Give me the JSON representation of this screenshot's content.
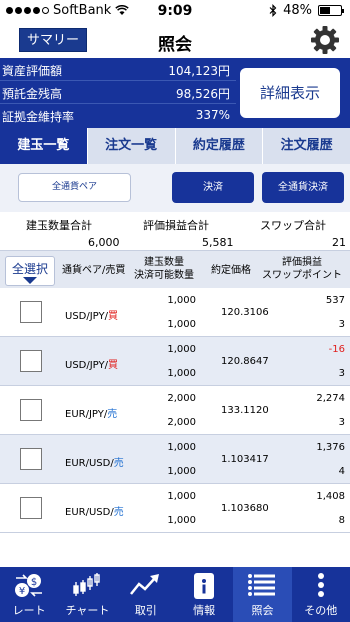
{
  "status": {
    "carrier": "SoftBank",
    "time": "9:09",
    "battery": "48%",
    "battery_level": 0.48
  },
  "nav": {
    "summary_label": "サマリー",
    "title": "照会"
  },
  "account": {
    "rows": [
      {
        "label": "資産評価額",
        "value": "104,123円"
      },
      {
        "label": "預託金残高",
        "value": "98,526円"
      },
      {
        "label": "証拠金維持率",
        "value": "337%"
      }
    ],
    "detail_label": "詳細表示"
  },
  "tabs": [
    {
      "label": "建玉一覧",
      "active": true
    },
    {
      "label": "注文一覧",
      "active": false
    },
    {
      "label": "約定履歴",
      "active": false
    },
    {
      "label": "注文履歴",
      "active": false
    }
  ],
  "actions": {
    "all_pairs": "全通貨ペア",
    "settle": "決済",
    "settle_all": "全通貨決済"
  },
  "totals": {
    "qty_label": "建玉数量合計",
    "qty_value": "6,000",
    "pl_label": "評価損益合計",
    "pl_value": "5,581",
    "swap_label": "スワップ合計",
    "swap_value": "21"
  },
  "table": {
    "select_all": "全選択",
    "headers": {
      "pair": "通貨ペア/売買",
      "qty1": "建玉数量",
      "qty2": "決済可能数量",
      "price": "約定価格",
      "pl1": "評価損益",
      "pl2": "スワップポイント"
    },
    "rows": [
      {
        "pair": "USD/JPY/",
        "side": "買",
        "side_type": "buy",
        "qty": "1,000",
        "settleable": "1,000",
        "price": "120.3106",
        "pl": "537",
        "pl_negative": false,
        "swap": "3"
      },
      {
        "pair": "USD/JPY/",
        "side": "買",
        "side_type": "buy",
        "qty": "1,000",
        "settleable": "1,000",
        "price": "120.8647",
        "pl": "-16",
        "pl_negative": true,
        "swap": "3"
      },
      {
        "pair": "EUR/JPY/",
        "side": "売",
        "side_type": "sell",
        "qty": "2,000",
        "settleable": "2,000",
        "price": "133.1120",
        "pl": "2,274",
        "pl_negative": false,
        "swap": "3"
      },
      {
        "pair": "EUR/USD/",
        "side": "売",
        "side_type": "sell",
        "qty": "1,000",
        "settleable": "1,000",
        "price": "1.103417",
        "pl": "1,376",
        "pl_negative": false,
        "swap": "4"
      },
      {
        "pair": "EUR/USD/",
        "side": "売",
        "side_type": "sell",
        "qty": "1,000",
        "settleable": "1,000",
        "price": "1.103680",
        "pl": "1,408",
        "pl_negative": false,
        "swap": "8"
      }
    ]
  },
  "footer": [
    {
      "label": "レート",
      "icon": "rate-icon",
      "active": false
    },
    {
      "label": "チャート",
      "icon": "chart-icon",
      "active": false
    },
    {
      "label": "取引",
      "icon": "trade-icon",
      "active": false
    },
    {
      "label": "情報",
      "icon": "info-icon",
      "active": false
    },
    {
      "label": "照会",
      "icon": "inquiry-list-icon",
      "active": true
    },
    {
      "label": "その他",
      "icon": "more-icon",
      "active": false
    }
  ]
}
